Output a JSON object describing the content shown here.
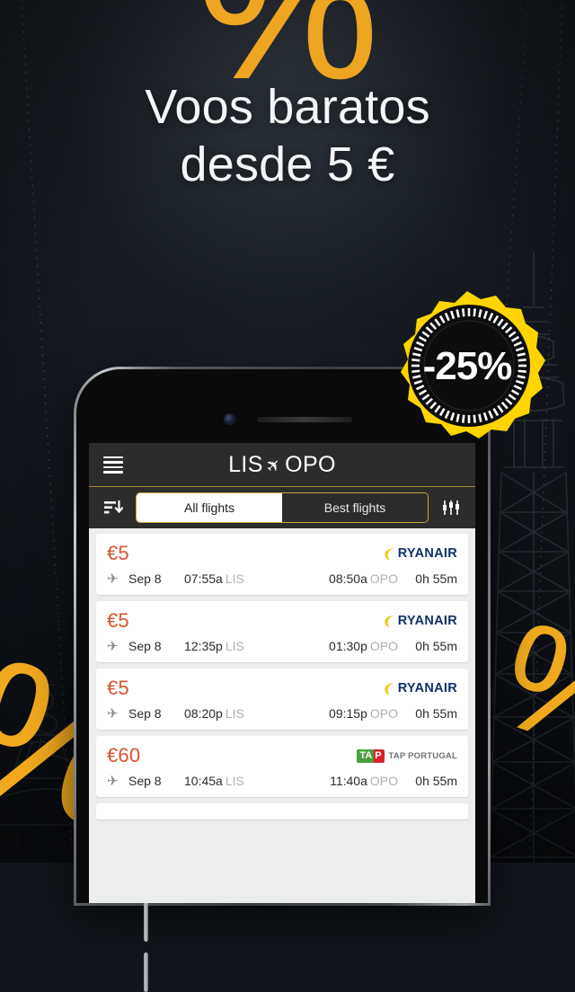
{
  "promo": {
    "headline_line1": "Voos baratos",
    "headline_line2": "desde 5 €",
    "percent_glyph": "%",
    "badge_label": "-25%",
    "accent_yellow": "#ffd400",
    "accent_orange": "#f0a81e",
    "background_color": "#12161c"
  },
  "app": {
    "menu_icon": "hamburger-icon",
    "title_origin": "LIS",
    "title_plane_icon": "✈",
    "title_destination": "OPO",
    "title_full": "LIS ✈ OPO",
    "toolbar": {
      "sort_icon": "sort-descending-icon",
      "filter_icon": "filter-sliders-icon",
      "segments": [
        {
          "label": "All flights",
          "selected": true
        },
        {
          "label": "Best flights",
          "selected": false
        }
      ]
    },
    "flights": [
      {
        "price": "€5",
        "airline": "Ryanair",
        "airline_logo": "ryanair-logo",
        "date": "Sep 8",
        "depart_time": "07:55a",
        "depart_airport": "LIS",
        "arrive_time": "08:50a",
        "arrive_airport": "OPO",
        "duration": "0h 55m"
      },
      {
        "price": "€5",
        "airline": "Ryanair",
        "airline_logo": "ryanair-logo",
        "date": "Sep 8",
        "depart_time": "12:35p",
        "depart_airport": "LIS",
        "arrive_time": "01:30p",
        "arrive_airport": "OPO",
        "duration": "0h 55m"
      },
      {
        "price": "€5",
        "airline": "Ryanair",
        "airline_logo": "ryanair-logo",
        "date": "Sep 8",
        "depart_time": "08:20p",
        "depart_airport": "LIS",
        "arrive_time": "09:15p",
        "arrive_airport": "OPO",
        "duration": "0h 55m"
      },
      {
        "price": "€60",
        "airline": "TAP PORTUGAL",
        "airline_logo": "tap-portugal-logo",
        "date": "Sep 8",
        "depart_time": "10:45a",
        "depart_airport": "LIS",
        "arrive_time": "11:40a",
        "arrive_airport": "OPO",
        "duration": "0h 55m"
      }
    ],
    "tap_logo": {
      "mark_left": "TA",
      "mark_right": "P",
      "wordmark": "TAP PORTUGAL"
    },
    "ryanair_logo": {
      "wordmark": "RYANAIR"
    }
  }
}
